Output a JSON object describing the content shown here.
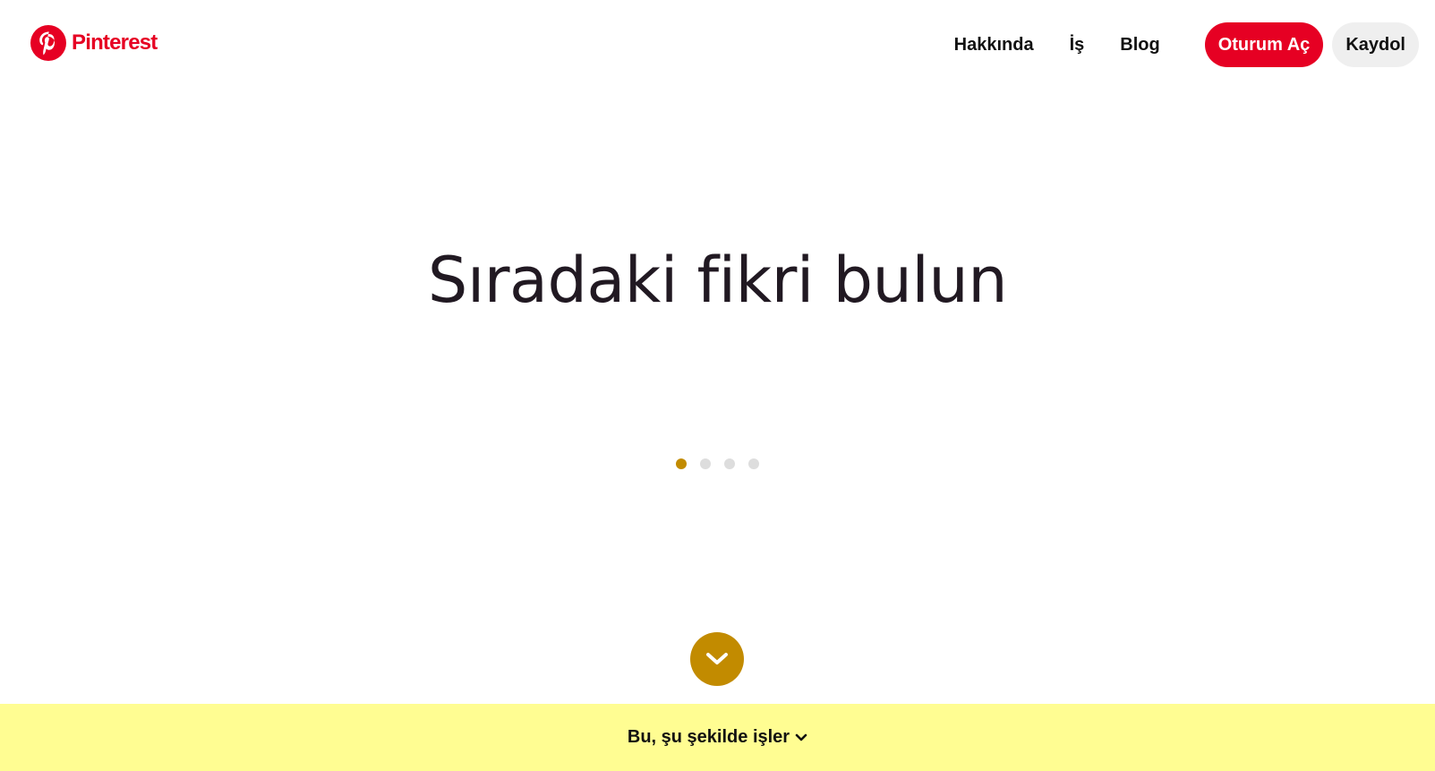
{
  "header": {
    "logo_text": "Pinterest",
    "nav": {
      "about": "Hakkında",
      "business": "İş",
      "blog": "Blog"
    },
    "login_label": "Oturum Aç",
    "signup_label": "Kaydol"
  },
  "hero": {
    "title": "Sıradaki fikri bulun",
    "carousel_dots": 4,
    "active_dot": 1
  },
  "banner": {
    "text": "Bu, şu şekilde işler"
  },
  "icons": {
    "logo": "pinterest-logo-icon",
    "scroll": "chevron-down-icon",
    "banner": "chevron-down-icon"
  },
  "colors": {
    "brand_red": "#e60023",
    "accent_gold": "#c28b00",
    "banner_yellow": "#fffd92",
    "signup_gray": "#efefef",
    "inactive_dot": "#dddddd",
    "title_text": "#211922"
  }
}
